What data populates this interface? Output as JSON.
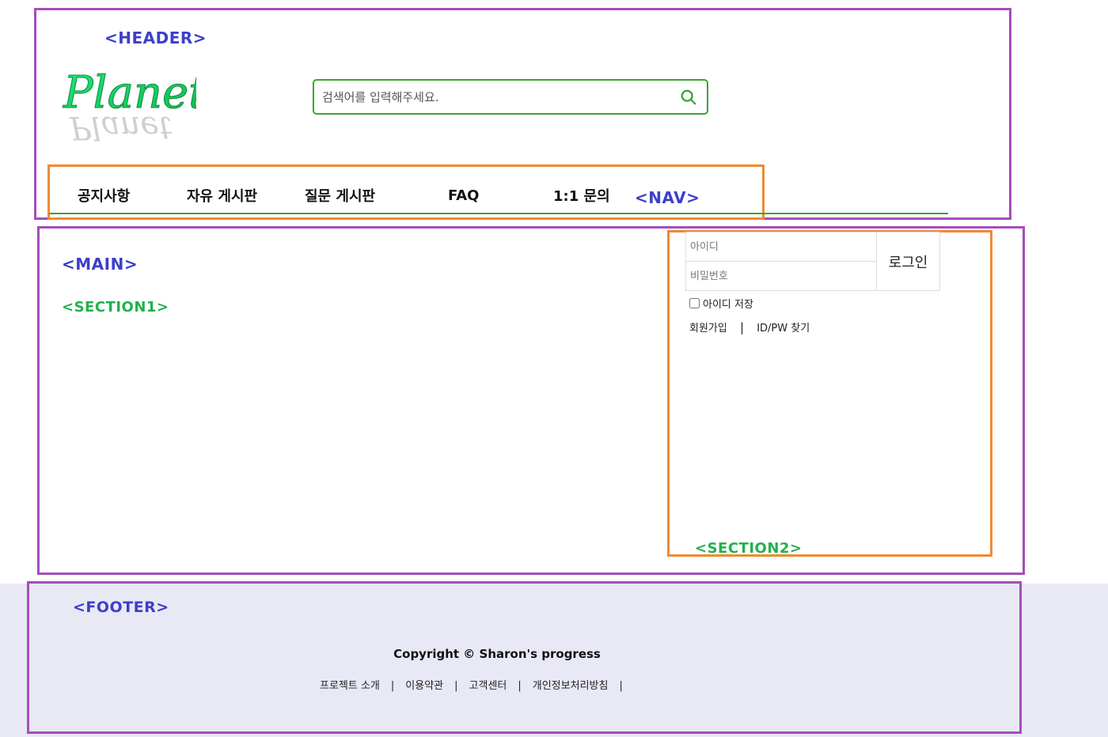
{
  "labels": {
    "header": "<HEADER>",
    "nav": "<NAV>",
    "main": "<MAIN>",
    "section1": "<SECTION1>",
    "section2": "<SECTION2>",
    "footer": "<FOOTER>"
  },
  "logo": {
    "text": "Planet"
  },
  "search": {
    "placeholder": "검색어를 입력해주세요.",
    "icon": "search-icon"
  },
  "nav": {
    "items": [
      {
        "label": "공지사항"
      },
      {
        "label": "자유 게시판"
      },
      {
        "label": "질문 게시판"
      },
      {
        "label": "FAQ"
      },
      {
        "label": "1:1 문의"
      }
    ]
  },
  "login": {
    "id_placeholder": "아이디",
    "pw_placeholder": "비밀번호",
    "button_label": "로그인",
    "remember_label": "아이디 저장",
    "signup_label": "회원가입",
    "separator": "|",
    "find_label": "ID/PW 찾기"
  },
  "footer": {
    "copyright": "Copyright © Sharon's progress",
    "links": [
      {
        "label": "프로젝트 소개"
      },
      {
        "label": "이용약관"
      },
      {
        "label": "고객센터"
      },
      {
        "label": "개인정보처리방침"
      }
    ],
    "separator": "|"
  },
  "colors": {
    "purple_box": "#a64dbb",
    "orange_box": "#f08a33",
    "accent_green": "#3aa62e",
    "tag_blue": "#3d3fc8",
    "tag_green": "#22b14c",
    "footer_bg": "#e8e9f5"
  }
}
